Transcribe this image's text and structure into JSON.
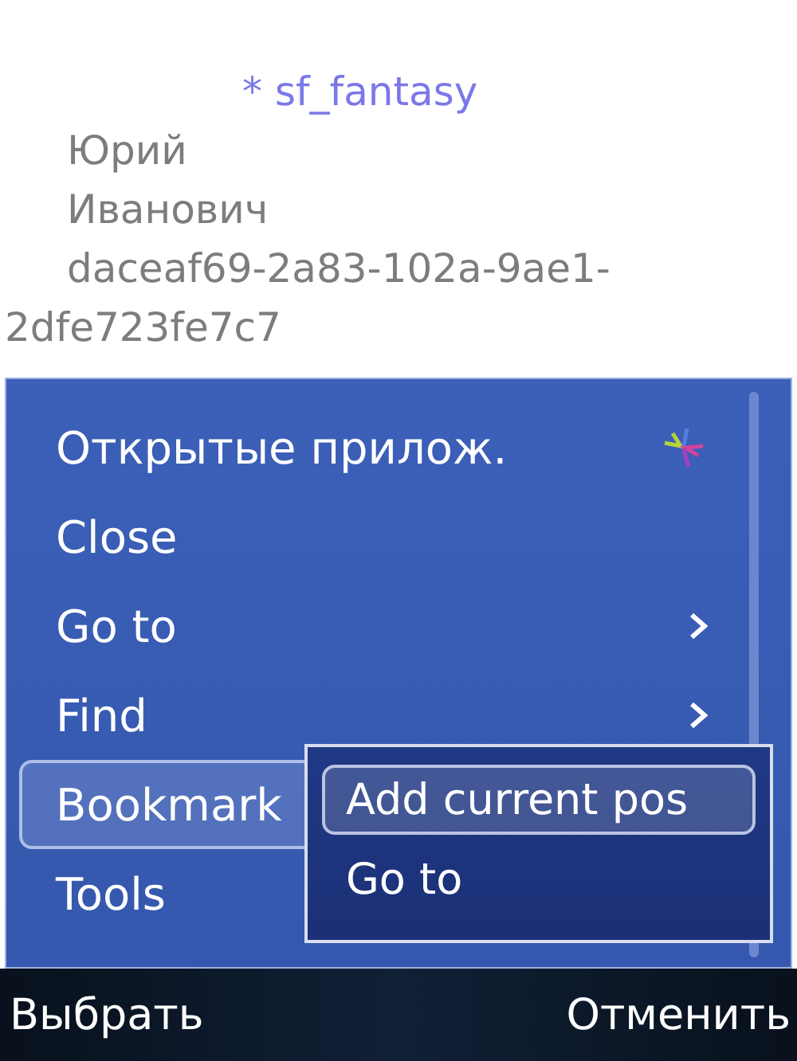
{
  "header": {
    "title": "* sf_fantasy",
    "lines": [
      "Юрий",
      "Иванович"
    ],
    "id_text": "daceaf69-2a83-102a-9ae1-2dfe723fe7c7"
  },
  "menu": {
    "items": [
      {
        "label": "Открытые прилож.",
        "kind": "apps",
        "arrow": false,
        "selected": false
      },
      {
        "label": "Close",
        "kind": "plain",
        "arrow": false,
        "selected": false
      },
      {
        "label": "Go to",
        "kind": "plain",
        "arrow": true,
        "selected": false
      },
      {
        "label": "Find",
        "kind": "plain",
        "arrow": true,
        "selected": false
      },
      {
        "label": "Bookmark",
        "kind": "plain",
        "arrow": false,
        "selected": true
      },
      {
        "label": "Tools",
        "kind": "plain",
        "arrow": false,
        "selected": false
      }
    ]
  },
  "submenu": {
    "items": [
      {
        "label": "Add current pos",
        "selected": true
      },
      {
        "label": "Go to",
        "selected": false
      }
    ]
  },
  "softkeys": {
    "left": "Выбрать",
    "right": "Отменить"
  }
}
